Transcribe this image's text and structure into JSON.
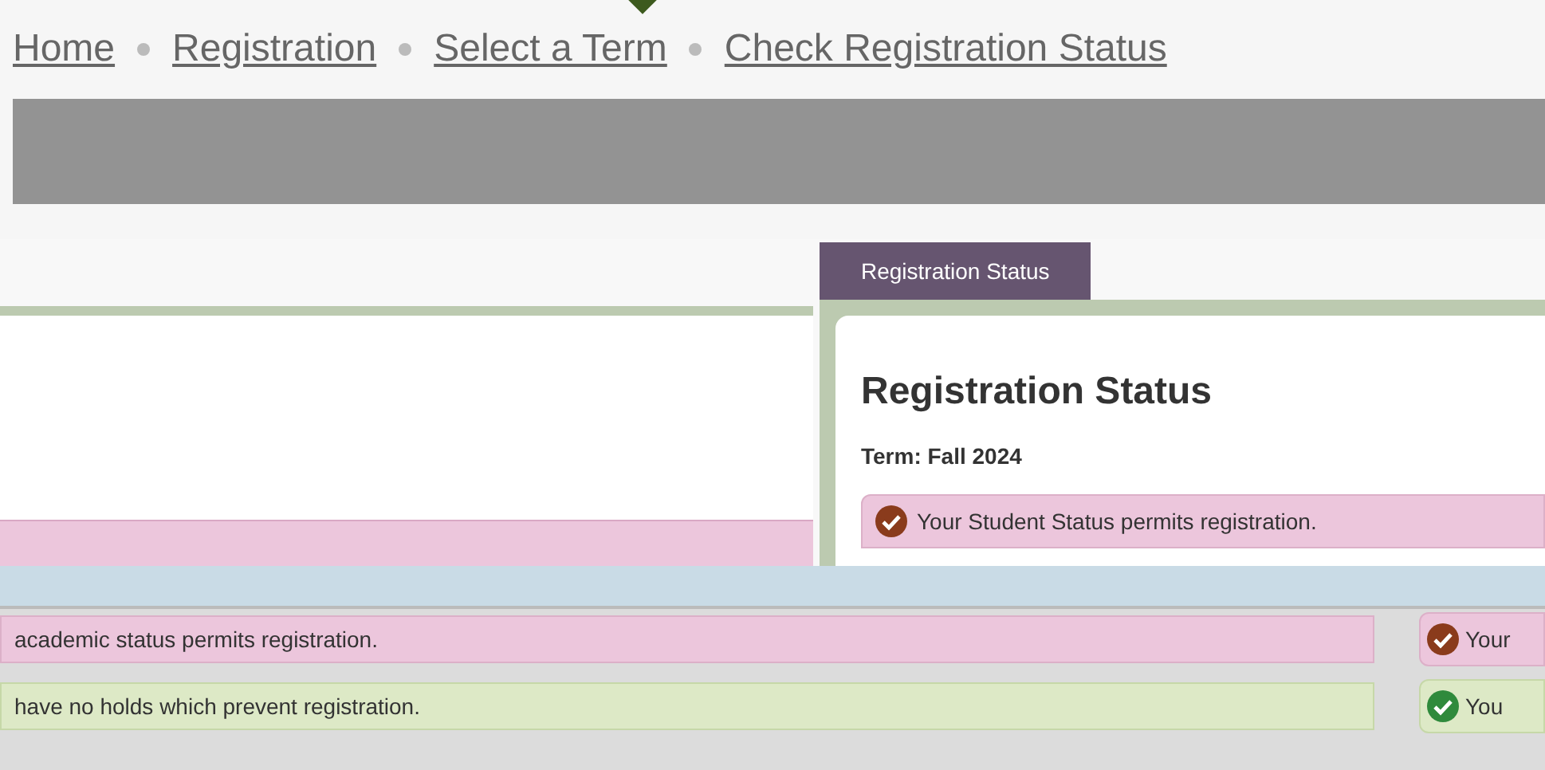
{
  "breadcrumb": [
    {
      "label": "Home"
    },
    {
      "label": "Registration"
    },
    {
      "label": "Select a Term"
    },
    {
      "label": "Check Registration Status"
    }
  ],
  "tabs": [
    {
      "label": "Registration Status",
      "selected": true
    }
  ],
  "panel": {
    "heading": "Registration Status",
    "term": "Term: Fall 2024",
    "messages": [
      {
        "kind": "warning",
        "text": "Your Student Status permits registration."
      }
    ]
  },
  "status_rows": [
    {
      "kind": "warning",
      "text": "academic status permits registration.",
      "side_text": "Your"
    },
    {
      "kind": "ok",
      "text": "have no holds which prevent registration.",
      "side_text": "You"
    }
  ]
}
